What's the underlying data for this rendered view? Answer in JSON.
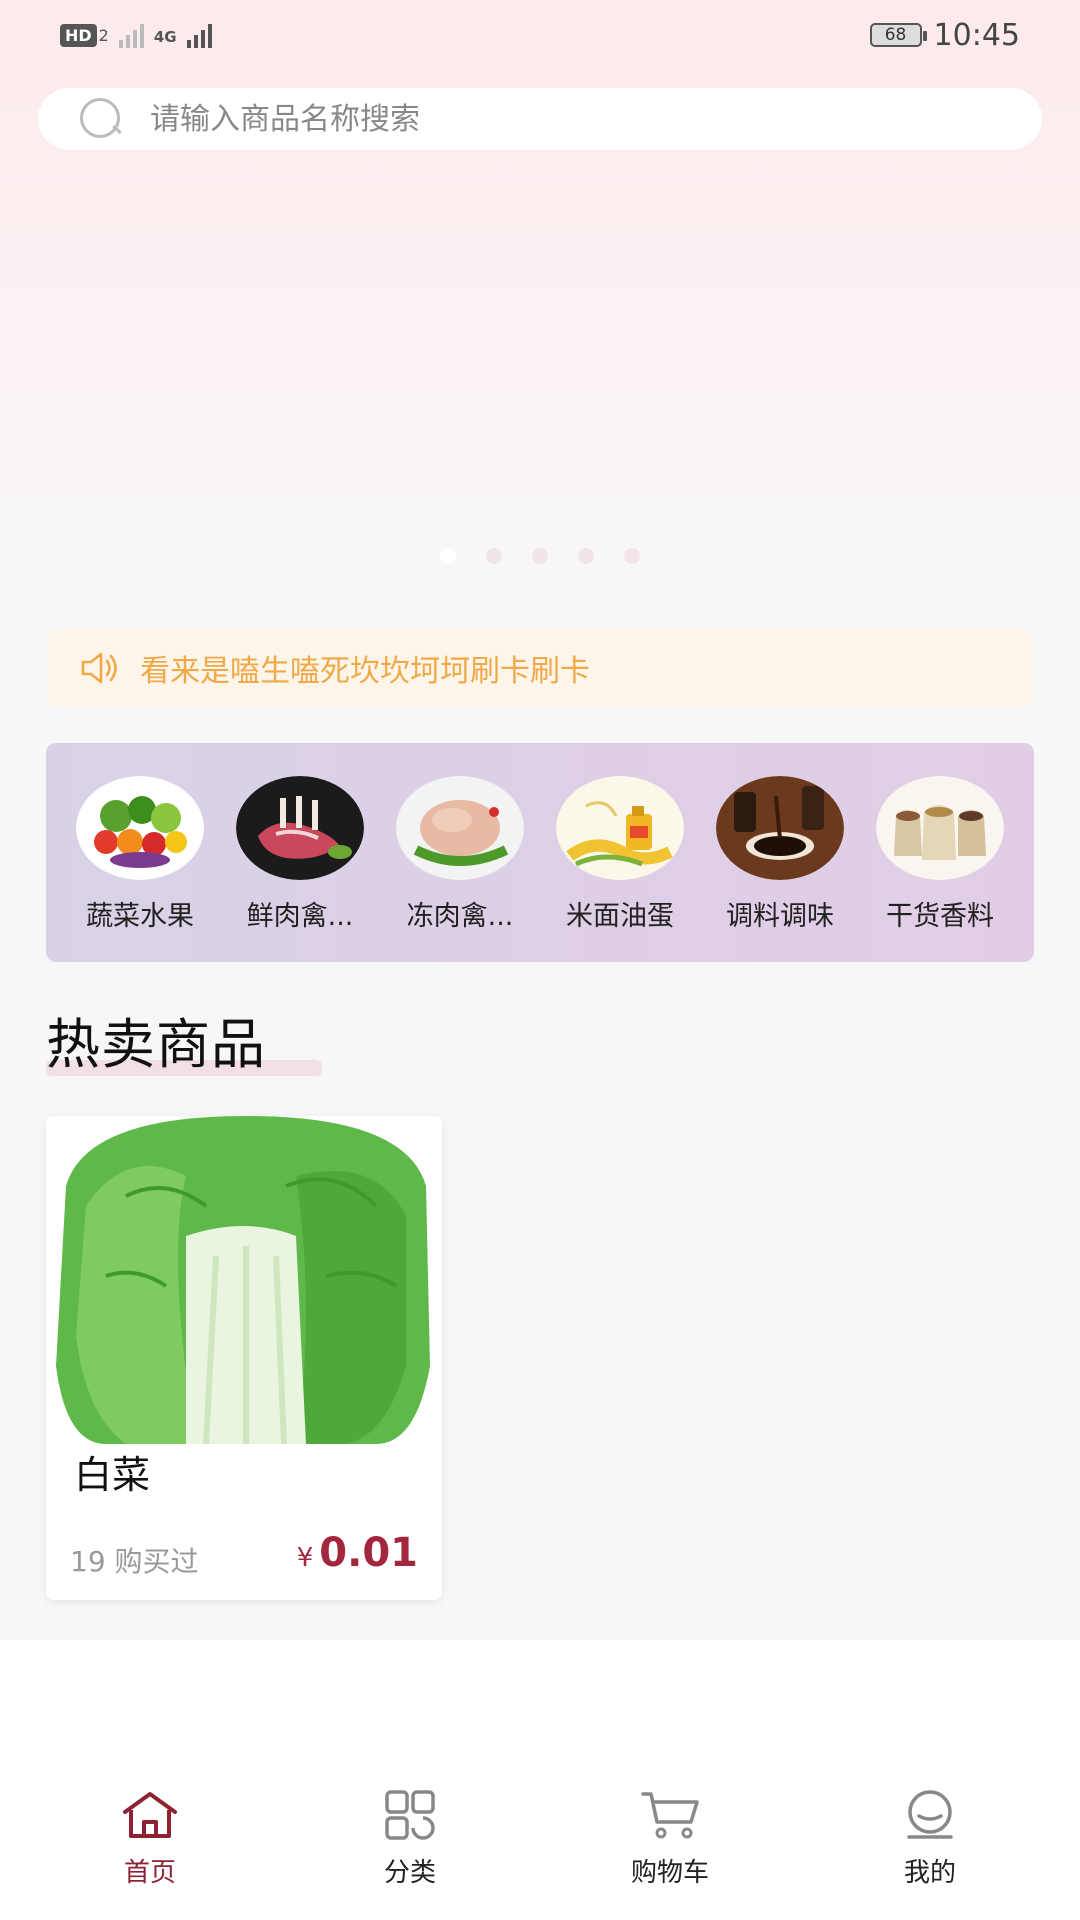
{
  "status_bar": {
    "hd": "HD",
    "hd_sub": "2",
    "network": "4G",
    "battery": "68",
    "time": "10:45"
  },
  "search": {
    "placeholder": "请输入商品名称搜索"
  },
  "notice": {
    "text": "看来是嗑生嗑死坎坎坷坷刷卡刷卡"
  },
  "categories": [
    {
      "label": "蔬菜水果",
      "icon": "vegetables-fruits-image"
    },
    {
      "label": "鲜肉禽...",
      "icon": "fresh-meat-image"
    },
    {
      "label": "冻肉禽...",
      "icon": "frozen-meat-image"
    },
    {
      "label": "米面油蛋",
      "icon": "rice-oil-image"
    },
    {
      "label": "调料调味",
      "icon": "seasoning-image"
    },
    {
      "label": "干货香料",
      "icon": "dry-goods-image"
    }
  ],
  "hot": {
    "title": "热卖商品",
    "products": [
      {
        "name": "白菜",
        "sold": "19 购买过",
        "price_symbol": "¥",
        "price": "0.01"
      }
    ]
  },
  "tab_bar": [
    {
      "label": "首页",
      "icon": "home-icon",
      "active": true
    },
    {
      "label": "分类",
      "icon": "category-icon",
      "active": false
    },
    {
      "label": "购物车",
      "icon": "cart-icon",
      "active": false
    },
    {
      "label": "我的",
      "icon": "profile-icon",
      "active": false
    }
  ],
  "colors": {
    "accent": "#8d2332",
    "price": "#a3263c",
    "notice_text": "#f0a946",
    "notice_bg": "#fdf4ea"
  }
}
